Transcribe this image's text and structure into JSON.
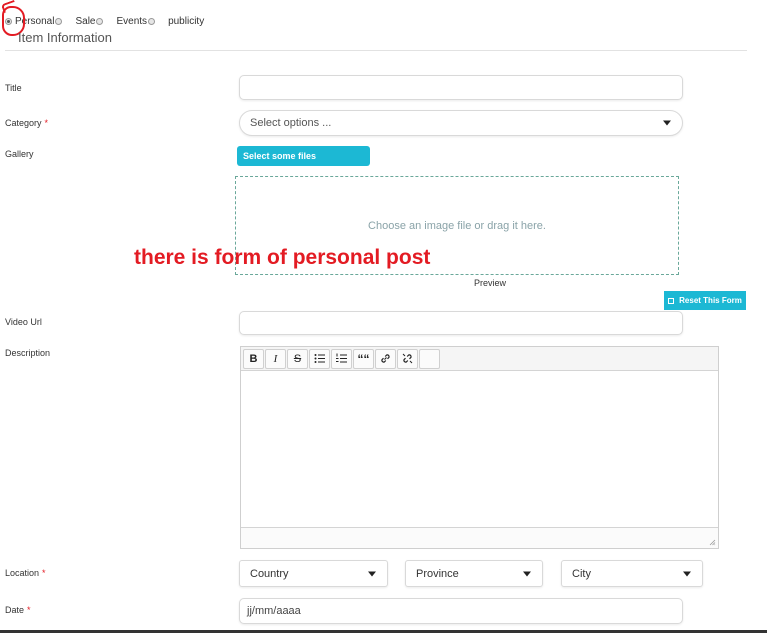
{
  "post_types": [
    {
      "label": "Personal",
      "checked": true
    },
    {
      "label": "Sale",
      "checked": false
    },
    {
      "label": "Events",
      "checked": false
    },
    {
      "label": "publicity",
      "checked": false
    }
  ],
  "section_title": "Item Information",
  "fields": {
    "title": {
      "label": "Title",
      "value": ""
    },
    "category": {
      "label": "Category",
      "required_mark": "*",
      "placeholder": "Select options ..."
    },
    "gallery": {
      "label": "Gallery",
      "button": "Select some files",
      "dropzone_text": "Choose an image file or drag it here.",
      "preview_label": "Preview"
    },
    "video_url": {
      "label": "Video Url",
      "value": ""
    },
    "description": {
      "label": "Description",
      "value": ""
    },
    "location": {
      "label": "Location",
      "required_mark": "*",
      "country": "Country",
      "province": "Province",
      "city": "City"
    },
    "date": {
      "label": "Date",
      "required_mark": "*",
      "placeholder": "jj/mm/aaaa"
    }
  },
  "reset_button": "Reset This Form",
  "editor_toolbar": [
    "bold-icon",
    "italic-icon",
    "strikethrough-icon",
    "bulleted-list-icon",
    "numbered-list-icon",
    "blockquote-icon",
    "link-icon",
    "unlink-icon"
  ],
  "toolbar_glyphs": {
    "bold": "B",
    "italic": "I",
    "strike": "S",
    "quote": "““"
  },
  "annotation": {
    "text": "there  is form of personal post",
    "color": "#e31b23"
  },
  "colors": {
    "accent": "#1cb8d4",
    "annotation": "#e31b23"
  }
}
